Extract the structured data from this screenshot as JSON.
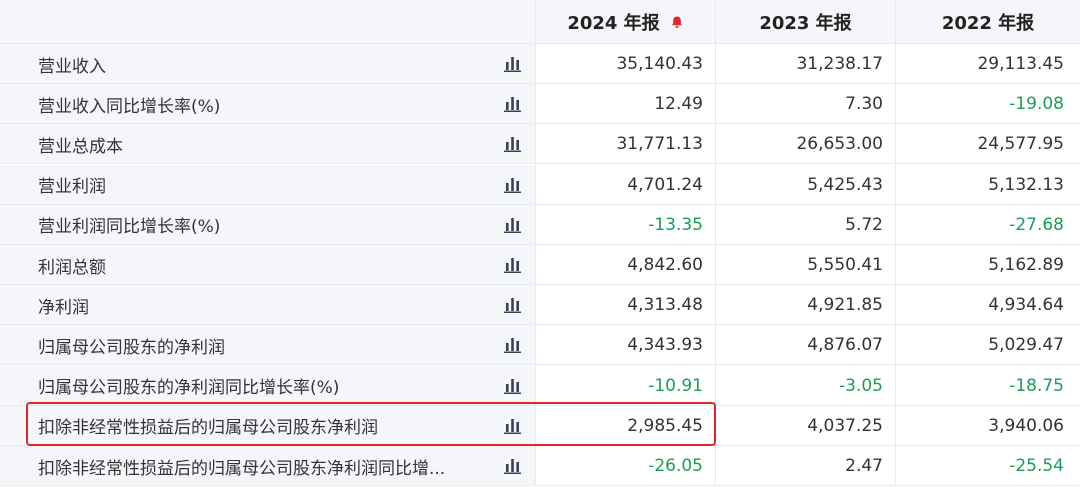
{
  "header": {
    "col1": "2024 年报",
    "col2": "2023 年报",
    "col3": "2022 年报"
  },
  "colors": {
    "negative": "#1a9e55",
    "highlight": "#e0262b",
    "bell": "#e0262b"
  },
  "rows": [
    {
      "label": "营业收入",
      "v2024": "35,140.43",
      "v2023": "31,238.17",
      "v2022": "29,113.45"
    },
    {
      "label": "营业收入同比增长率(%)",
      "v2024": "12.49",
      "v2023": "7.30",
      "v2022": "-19.08"
    },
    {
      "label": "营业总成本",
      "v2024": "31,771.13",
      "v2023": "26,653.00",
      "v2022": "24,577.95"
    },
    {
      "label": "营业利润",
      "v2024": "4,701.24",
      "v2023": "5,425.43",
      "v2022": "5,132.13"
    },
    {
      "label": "营业利润同比增长率(%)",
      "v2024": "-13.35",
      "v2023": "5.72",
      "v2022": "-27.68"
    },
    {
      "label": "利润总额",
      "v2024": "4,842.60",
      "v2023": "5,550.41",
      "v2022": "5,162.89"
    },
    {
      "label": "净利润",
      "v2024": "4,313.48",
      "v2023": "4,921.85",
      "v2022": "4,934.64"
    },
    {
      "label": "归属母公司股东的净利润",
      "v2024": "4,343.93",
      "v2023": "4,876.07",
      "v2022": "5,029.47"
    },
    {
      "label": "归属母公司股东的净利润同比增长率(%)",
      "v2024": "-10.91",
      "v2023": "-3.05",
      "v2022": "-18.75"
    },
    {
      "label": "扣除非经常性损益后的归属母公司股东净利润",
      "v2024": "2,985.45",
      "v2023": "4,037.25",
      "v2022": "3,940.06"
    },
    {
      "label": "扣除非经常性损益后的归属母公司股东净利润同比增...",
      "v2024": "-26.05",
      "v2023": "2.47",
      "v2022": "-25.54"
    }
  ]
}
